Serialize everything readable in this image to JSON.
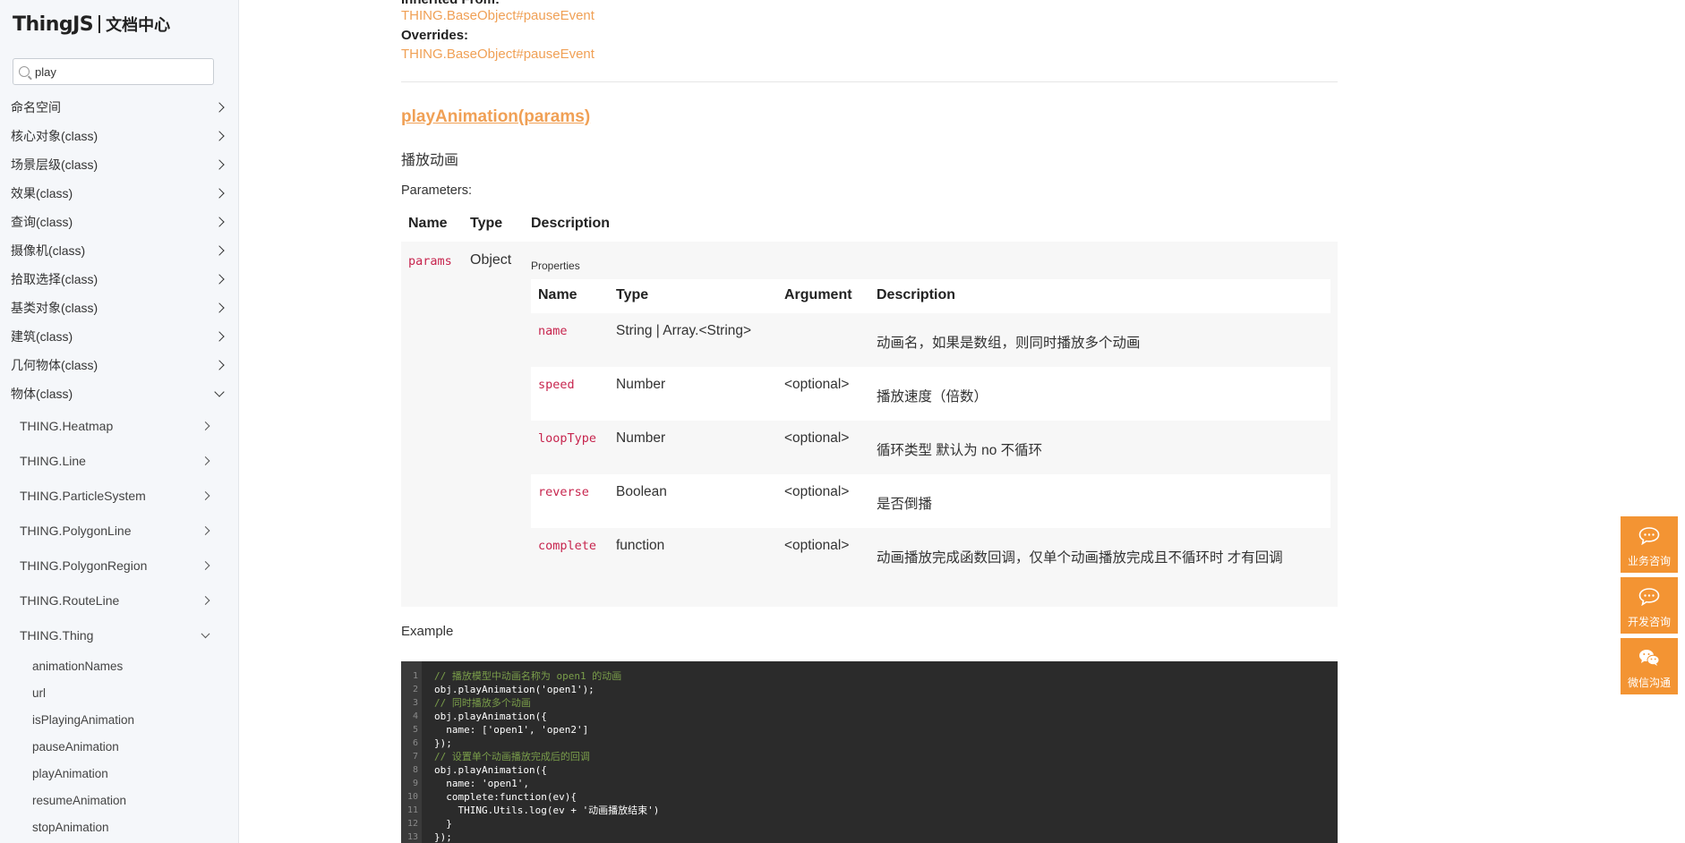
{
  "logo": {
    "main": "ThingJS",
    "sub": "文档中心"
  },
  "search": {
    "value": "play"
  },
  "nav": {
    "items": [
      {
        "label": "命名空间",
        "expanded": false
      },
      {
        "label": "核心对象(class)",
        "expanded": false
      },
      {
        "label": "场景层级(class)",
        "expanded": false
      },
      {
        "label": "效果(class)",
        "expanded": false
      },
      {
        "label": "查询(class)",
        "expanded": false
      },
      {
        "label": "摄像机(class)",
        "expanded": false
      },
      {
        "label": "拾取选择(class)",
        "expanded": false
      },
      {
        "label": "基类对象(class)",
        "expanded": false
      },
      {
        "label": "建筑(class)",
        "expanded": false
      },
      {
        "label": "几何物体(class)",
        "expanded": false
      },
      {
        "label": "物体(class)",
        "expanded": true
      }
    ],
    "sub_items": [
      "THING.Heatmap",
      "THING.Line",
      "THING.ParticleSystem",
      "THING.PolygonLine",
      "THING.PolygonRegion",
      "THING.RouteLine",
      "THING.Thing"
    ],
    "leaf_items": [
      "animationNames",
      "url",
      "isPlayingAnimation",
      "pauseAnimation",
      "playAnimation",
      "resumeAnimation",
      "stopAnimation"
    ]
  },
  "doc": {
    "inherited_label": "Inherited From:",
    "inherited_link": "THING.BaseObject#pauseEvent",
    "overrides_label": "Overrides:",
    "overrides_link": "THING.BaseObject#pauseEvent",
    "method_title": "playAnimation(params)",
    "method_desc": "播放动画",
    "params_label": "Parameters:",
    "table_headers": [
      "Name",
      "Type",
      "Description"
    ],
    "param_name": "params",
    "param_type": "Object",
    "properties_label": "Properties",
    "inner_headers": [
      "Name",
      "Type",
      "Argument",
      "Description"
    ],
    "props": [
      {
        "name": "name",
        "type": "String | Array.<String>",
        "argument": "",
        "desc": "动画名，如果是数组，则同时播放多个动画"
      },
      {
        "name": "speed",
        "type": "Number",
        "argument": "<optional>",
        "desc": "播放速度（倍数）"
      },
      {
        "name": "loopType",
        "type": "Number",
        "argument": "<optional>",
        "desc": "循环类型 默认为 no 不循环"
      },
      {
        "name": "reverse",
        "type": "Boolean",
        "argument": "<optional>",
        "desc": "是否倒播"
      },
      {
        "name": "complete",
        "type": "function",
        "argument": "<optional>",
        "desc": "动画播放完成函数回调，仅单个动画播放完成且不循环时 才有回调"
      }
    ],
    "example_label": "Example",
    "code_lines": [
      {
        "num": "1",
        "text": "// 播放模型中动画名称为 open1 的动画"
      },
      {
        "num": "2",
        "text": "obj.playAnimation('open1');"
      },
      {
        "num": "3",
        "text": "// 同时播放多个动画"
      },
      {
        "num": "4",
        "text": "obj.playAnimation({"
      },
      {
        "num": "5",
        "text": "  name: ['open1', 'open2']"
      },
      {
        "num": "6",
        "text": "});"
      },
      {
        "num": "7",
        "text": "// 设置单个动画播放完成后的回调"
      },
      {
        "num": "8",
        "text": "obj.playAnimation({"
      },
      {
        "num": "9",
        "text": "  name: 'open1',"
      },
      {
        "num": "10",
        "text": "  complete:function(ev){"
      },
      {
        "num": "11",
        "text": "    THING.Utils.log(ev + '动画播放结束')"
      },
      {
        "num": "12",
        "text": "  }"
      },
      {
        "num": "13",
        "text": "});"
      }
    ]
  },
  "float_buttons": [
    {
      "label": "业务咨询",
      "icon": "chat-icon"
    },
    {
      "label": "开发咨询",
      "icon": "chat-icon"
    },
    {
      "label": "微信沟通",
      "icon": "wechat-icon"
    }
  ],
  "colors": {
    "accent_orange": "#f0a055",
    "float_orange": "#f39433",
    "code_bg": "#2b2b2b",
    "param_red": "#c7254e"
  }
}
